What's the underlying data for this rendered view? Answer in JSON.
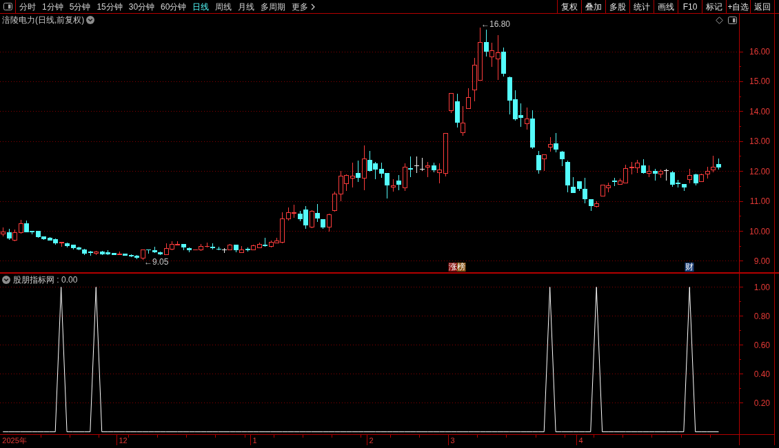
{
  "toolbar": {
    "periods": [
      {
        "label": "分时",
        "selected": false
      },
      {
        "label": "1分钟",
        "selected": false
      },
      {
        "label": "5分钟",
        "selected": false
      },
      {
        "label": "15分钟",
        "selected": false
      },
      {
        "label": "30分钟",
        "selected": false
      },
      {
        "label": "60分钟",
        "selected": false
      },
      {
        "label": "日线",
        "selected": true
      },
      {
        "label": "周线",
        "selected": false
      },
      {
        "label": "月线",
        "selected": false
      },
      {
        "label": "多周期",
        "selected": false
      }
    ],
    "more": "更多",
    "buttons": [
      "复权",
      "叠加",
      "多股",
      "统计",
      "画线",
      "F10",
      "标记",
      "+自选",
      "返回"
    ]
  },
  "chart": {
    "chart_data": [
      {
        "type": "candlestick",
        "title": "涪陵电力(日线,前复权)",
        "ylim": [
          8.62,
          17.278
        ],
        "yticks": [
          {
            "value": 9,
            "label": "9.00"
          },
          {
            "value": 10,
            "label": "10.00"
          },
          {
            "value": 11,
            "label": "11.00"
          },
          {
            "value": 12,
            "label": "12.00"
          },
          {
            "value": 13,
            "label": "13.00"
          },
          {
            "value": 14,
            "label": "14.00"
          },
          {
            "value": 15,
            "label": "15.00"
          },
          {
            "value": 16,
            "label": "16.00"
          }
        ],
        "grid": true,
        "annotations": [
          "←16.80",
          "←9.05"
        ],
        "ohlc": [
          [
            9.91,
            10.12,
            9.85,
            9.99
          ],
          [
            9.96,
            10.06,
            9.73,
            9.77
          ],
          [
            9.71,
            10.04,
            9.68,
            9.96
          ],
          [
            9.96,
            10.37,
            9.93,
            10.25
          ],
          [
            10.25,
            10.34,
            9.97,
            9.99
          ],
          [
            10.0,
            10.0,
            9.91,
            9.99
          ],
          [
            10.0,
            10.0,
            9.8,
            9.81
          ],
          [
            9.81,
            9.82,
            9.72,
            9.74
          ],
          [
            9.78,
            9.79,
            9.7,
            9.71
          ],
          [
            9.72,
            9.75,
            9.57,
            9.62
          ],
          [
            9.62,
            9.64,
            9.49,
            9.64
          ],
          [
            9.59,
            9.62,
            9.48,
            9.52
          ],
          [
            9.53,
            9.54,
            9.41,
            9.44
          ],
          [
            9.45,
            9.47,
            9.38,
            9.41
          ],
          [
            9.38,
            9.41,
            9.21,
            9.27
          ],
          [
            9.3,
            9.34,
            9.19,
            9.29
          ],
          [
            9.26,
            9.33,
            9.23,
            9.3
          ],
          [
            9.31,
            9.34,
            9.23,
            9.25
          ],
          [
            9.28,
            9.36,
            9.23,
            9.25
          ],
          [
            9.26,
            9.27,
            9.21,
            9.23
          ],
          [
            9.21,
            9.31,
            9.21,
            9.24
          ],
          [
            9.24,
            9.25,
            9.19,
            9.2
          ],
          [
            9.2,
            9.21,
            9.16,
            9.17
          ],
          [
            9.18,
            9.19,
            9.08,
            9.12
          ],
          [
            9.1,
            9.37,
            9.05,
            9.37
          ],
          [
            9.39,
            9.39,
            9.26,
            9.38
          ],
          [
            9.36,
            9.48,
            9.29,
            9.3
          ],
          [
            9.29,
            9.3,
            9.23,
            9.25
          ],
          [
            9.23,
            9.58,
            9.21,
            9.42
          ],
          [
            9.41,
            9.66,
            9.39,
            9.57
          ],
          [
            9.55,
            9.66,
            9.55,
            9.56
          ],
          [
            9.56,
            9.57,
            9.38,
            9.47
          ],
          [
            9.43,
            9.44,
            9.31,
            9.39
          ],
          [
            9.37,
            9.38,
            9.37,
            9.38
          ],
          [
            9.38,
            9.56,
            9.36,
            9.5
          ],
          [
            9.49,
            9.62,
            9.48,
            9.5
          ],
          [
            9.47,
            9.59,
            9.41,
            9.45
          ],
          [
            9.41,
            9.47,
            9.38,
            9.4
          ],
          [
            9.37,
            9.42,
            9.29,
            9.37
          ],
          [
            9.39,
            9.56,
            9.38,
            9.54
          ],
          [
            9.53,
            9.54,
            9.31,
            9.39
          ],
          [
            9.29,
            9.49,
            9.28,
            9.39
          ],
          [
            9.4,
            9.45,
            9.33,
            9.38
          ],
          [
            9.38,
            9.54,
            9.37,
            9.51
          ],
          [
            9.46,
            9.61,
            9.45,
            9.57
          ],
          [
            9.54,
            9.77,
            9.49,
            9.51
          ],
          [
            9.49,
            9.67,
            9.48,
            9.64
          ],
          [
            9.62,
            9.76,
            9.6,
            9.67
          ],
          [
            9.64,
            10.62,
            9.62,
            10.41
          ],
          [
            10.41,
            10.78,
            10.38,
            10.62
          ],
          [
            10.6,
            10.88,
            10.47,
            10.63
          ],
          [
            10.57,
            10.68,
            10.34,
            10.42
          ],
          [
            10.72,
            10.84,
            10.09,
            10.22
          ],
          [
            10.15,
            10.7,
            10.12,
            10.68
          ],
          [
            10.6,
            10.9,
            10.32,
            10.43
          ],
          [
            10.39,
            10.4,
            10.09,
            10.15
          ],
          [
            10.15,
            10.57,
            10.0,
            10.55
          ],
          [
            10.69,
            11.32,
            10.67,
            11.25
          ],
          [
            11.25,
            12.01,
            11.02,
            11.85
          ],
          [
            11.58,
            11.88,
            11.35,
            11.87
          ],
          [
            11.78,
            12.27,
            11.48,
            11.85
          ],
          [
            11.94,
            12.34,
            11.65,
            11.79
          ],
          [
            11.78,
            12.85,
            11.39,
            12.41
          ],
          [
            12.37,
            12.68,
            12.01,
            12.02
          ],
          [
            12.25,
            12.3,
            11.76,
            12.08
          ],
          [
            12.08,
            12.27,
            11.79,
            11.94
          ],
          [
            11.93,
            11.94,
            11.1,
            11.55
          ],
          [
            11.47,
            11.74,
            11.33,
            11.53
          ],
          [
            11.68,
            11.87,
            11.39,
            11.56
          ],
          [
            11.45,
            12.26,
            11.35,
            12.14
          ],
          [
            12.09,
            12.49,
            11.81,
            12.08
          ],
          [
            12.18,
            12.49,
            11.95,
            12.18
          ],
          [
            12.08,
            12.44,
            12.03,
            12.08
          ],
          [
            12.14,
            12.31,
            11.81,
            12.2
          ],
          [
            12.18,
            12.29,
            11.98,
            12.04
          ],
          [
            11.96,
            12.26,
            11.61,
            12.05
          ],
          [
            11.93,
            13.27,
            11.85,
            13.27
          ],
          [
            14.03,
            14.61,
            13.96,
            14.61
          ],
          [
            14.34,
            14.59,
            13.47,
            13.63
          ],
          [
            13.29,
            14.17,
            13.2,
            13.62
          ],
          [
            14.1,
            14.77,
            14.1,
            14.48
          ],
          [
            14.72,
            15.77,
            14.35,
            15.55
          ],
          [
            15.04,
            16.8,
            15.04,
            16.32
          ],
          [
            16.3,
            16.73,
            15.85,
            16.02
          ],
          [
            15.83,
            16.28,
            15.5,
            16.04
          ],
          [
            15.75,
            16.55,
            15.06,
            15.96
          ],
          [
            16.0,
            16.13,
            15.19,
            15.27
          ],
          [
            15.13,
            15.16,
            13.91,
            14.37
          ],
          [
            14.41,
            14.71,
            13.71,
            13.75
          ],
          [
            13.86,
            14.27,
            13.5,
            13.8
          ],
          [
            13.6,
            14.13,
            13.41,
            13.76
          ],
          [
            13.76,
            14.04,
            12.76,
            12.8
          ],
          [
            12.54,
            12.68,
            11.93,
            12.06
          ],
          [
            12.42,
            12.56,
            12.02,
            12.56
          ],
          [
            12.81,
            13.14,
            12.67,
            12.9
          ],
          [
            12.93,
            13.26,
            12.64,
            12.74
          ],
          [
            12.64,
            12.67,
            12.18,
            12.41
          ],
          [
            12.31,
            12.34,
            11.31,
            11.54
          ],
          [
            11.48,
            11.8,
            11.28,
            11.3
          ],
          [
            11.65,
            11.66,
            11.35,
            11.43
          ],
          [
            11.41,
            11.78,
            10.95,
            11.08
          ],
          [
            11.06,
            11.06,
            10.69,
            10.85
          ],
          [
            10.83,
            10.99,
            10.8,
            10.93
          ],
          [
            11.18,
            11.55,
            11.18,
            11.55
          ],
          [
            11.45,
            11.62,
            11.32,
            11.53
          ],
          [
            11.69,
            11.77,
            11.51,
            11.67
          ],
          [
            11.57,
            11.75,
            11.57,
            11.68
          ],
          [
            11.62,
            12.21,
            11.62,
            12.1
          ],
          [
            12.13,
            12.31,
            11.91,
            12.14
          ],
          [
            12.12,
            12.37,
            11.95,
            12.29
          ],
          [
            12.2,
            12.39,
            11.93,
            11.95
          ],
          [
            11.94,
            12.2,
            11.81,
            12.01
          ],
          [
            12.01,
            12.08,
            11.7,
            11.94
          ],
          [
            11.92,
            12.06,
            11.8,
            12.01
          ],
          [
            12.03,
            12.08,
            11.7,
            12.03
          ],
          [
            11.95,
            12.0,
            11.49,
            11.57
          ],
          [
            11.61,
            11.71,
            11.47,
            11.6
          ],
          [
            11.57,
            11.57,
            11.35,
            11.47
          ],
          [
            11.74,
            12.08,
            11.62,
            11.87
          ],
          [
            11.88,
            11.91,
            11.55,
            11.62
          ],
          [
            11.66,
            11.91,
            11.66,
            11.88
          ],
          [
            11.91,
            12.15,
            11.78,
            12.01
          ],
          [
            12.04,
            12.52,
            11.98,
            12.15
          ],
          [
            12.24,
            12.41,
            12.08,
            12.14
          ],
          null,
          null,
          null
        ]
      },
      {
        "type": "line",
        "title": "股朋指标网 : 0.00",
        "color": "#ffffff",
        "ylim": [
          -0.0190476,
          1.0952381
        ],
        "yticks": [
          {
            "value": 0.2,
            "label": "0.20"
          },
          {
            "value": 0.4,
            "label": "0.40"
          },
          {
            "value": 0.6,
            "label": "0.60"
          },
          {
            "value": 0.8,
            "label": "0.80"
          },
          {
            "value": 1,
            "label": "1.00"
          }
        ],
        "grid": true,
        "categories": [
          null,
          null,
          "2025年",
          null,
          null,
          null,
          null,
          null,
          null,
          null,
          null,
          null,
          null,
          null,
          null,
          null,
          null,
          null,
          null,
          null,
          "12",
          null,
          null,
          null,
          null,
          null,
          null,
          null,
          null,
          null,
          null,
          null,
          null,
          null,
          null,
          null,
          null,
          null,
          null,
          null,
          null,
          null,
          null,
          "1",
          null,
          null,
          null,
          null,
          null,
          null,
          null,
          null,
          null,
          null,
          null,
          null,
          null,
          null,
          null,
          null,
          null,
          null,
          null,
          "2",
          null,
          null,
          null,
          null,
          null,
          null,
          null,
          null,
          null,
          null,
          null,
          null,
          null,
          "3",
          null,
          null,
          null,
          null,
          null,
          null,
          null,
          null,
          null,
          null,
          null,
          null,
          null,
          null,
          null,
          null,
          null,
          null,
          null,
          null,
          null,
          "4",
          null,
          null,
          null,
          null,
          null,
          null,
          null,
          null,
          null,
          null,
          null,
          null,
          null,
          null,
          null,
          null,
          null,
          null,
          null,
          null,
          null,
          null,
          null,
          null,
          null,
          null,
          null
        ],
        "values": [
          0,
          0,
          0,
          0,
          0,
          0,
          0,
          0,
          0,
          0,
          1,
          0,
          0,
          0,
          0,
          0,
          1,
          0,
          0,
          0,
          0,
          0,
          0,
          0,
          0,
          0,
          0,
          0,
          0,
          0,
          0,
          0,
          0,
          0,
          0,
          0,
          0,
          0,
          0,
          0,
          0,
          0,
          0,
          0,
          0,
          0,
          0,
          0,
          0,
          0,
          0,
          0,
          0,
          0,
          0,
          0,
          0,
          0,
          0,
          0,
          0,
          0,
          0,
          0,
          0,
          0,
          0,
          0,
          0,
          0,
          0,
          0,
          0,
          0,
          0,
          0,
          0,
          0,
          0,
          0,
          0,
          0,
          0,
          0,
          0,
          0,
          0,
          0,
          0,
          0,
          0,
          0,
          0,
          0,
          1,
          0,
          0,
          0,
          0,
          0,
          0,
          0,
          1,
          0,
          0,
          0,
          0,
          0,
          0,
          0,
          0,
          0,
          0,
          0,
          0,
          0,
          0,
          0,
          1,
          0,
          0,
          0,
          0,
          0,
          null,
          null,
          null
        ]
      }
    ],
    "event_markers": [
      {
        "label": "涨榜",
        "kind": "limit_up"
      },
      {
        "label": "财",
        "kind": "finance"
      }
    ]
  }
}
